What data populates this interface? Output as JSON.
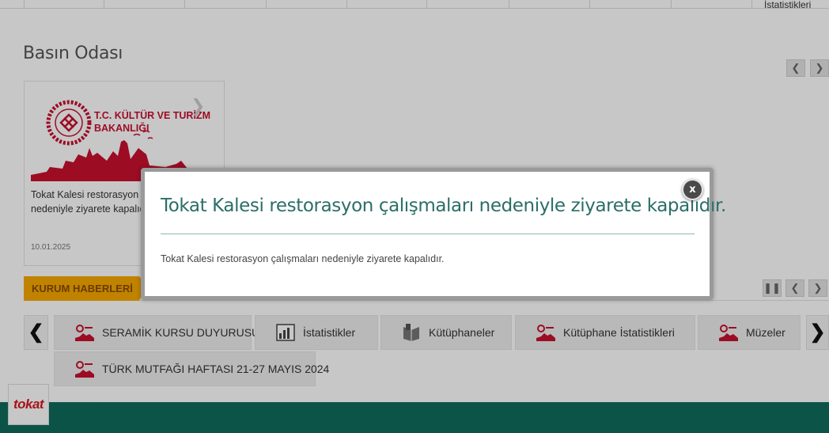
{
  "top_tabs": {
    "last_label": "İstatistikleri"
  },
  "press_room": {
    "title": "Basın Odası",
    "prev_icon": "chevron-left-icon",
    "next_icon": "chevron-right-icon",
    "card": {
      "logo_text_line1": "T.C. KÜLTÜR VE TURİZM",
      "logo_text_line2": "BAKANLIĞI",
      "text": "Tokat Kalesi restorasyon çalışmaları nedeniyle ziyarete kapalıdır.",
      "date": "10.01.2025"
    }
  },
  "institution_news": {
    "label": "KURUM HABERLERİ"
  },
  "quick_links": [
    {
      "label": "SERAMİK KURSU DUYURUSU",
      "icon": "ministry-logo-icon"
    },
    {
      "label": "İstatistikler",
      "icon": "statistics-icon"
    },
    {
      "label": "Kütüphaneler",
      "icon": "library-icon"
    },
    {
      "label": "Kütüphane İstatistikleri",
      "icon": "ministry-logo-icon"
    },
    {
      "label": "Müzeler",
      "icon": "ministry-logo-icon"
    },
    {
      "label": "TÜRK MUTFAĞI HAFTASI 21-27 MAYIS 2024",
      "icon": "ministry-logo-icon"
    }
  ],
  "footer_logo": {
    "text": "tokat"
  },
  "modal": {
    "title": "Tokat Kalesi restorasyon çalışmaları nedeniyle ziyarete kapalıdır.",
    "body": "Tokat Kalesi restorasyon çalışmaları nedeniyle ziyarete kapalıdır.",
    "close_label": "x"
  },
  "colors": {
    "accent_teal": "#2a6e68",
    "news_label_orange": "#f6a800",
    "footer_green": "#0f6b5c",
    "ministry_red": "#c8102e"
  }
}
